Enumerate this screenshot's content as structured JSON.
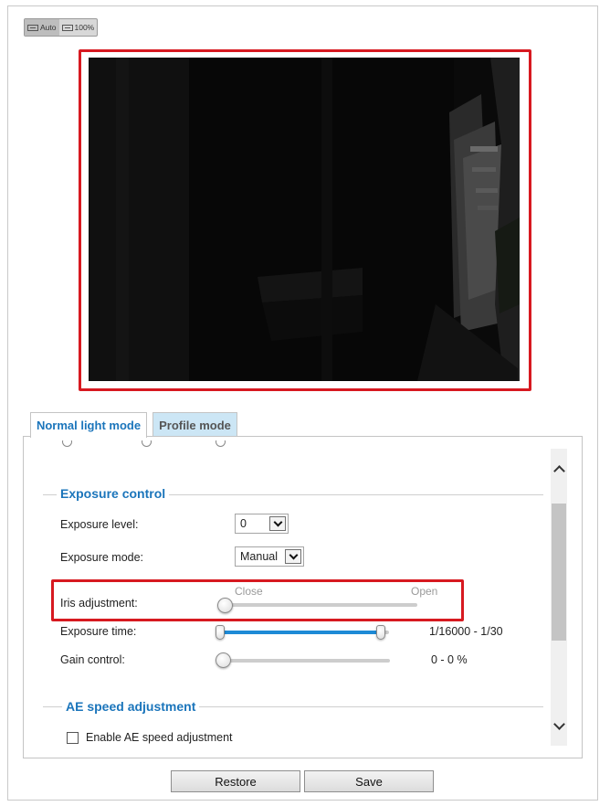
{
  "view_toggle": {
    "auto_label": "Auto",
    "full_label": "100%"
  },
  "tabs": {
    "normal": "Normal light mode",
    "profile": "Profile mode"
  },
  "exposure_control": {
    "title": "Exposure control",
    "exposure_level": {
      "label": "Exposure level:",
      "value": "0"
    },
    "exposure_mode": {
      "label": "Exposure mode:",
      "value": "Manual"
    },
    "iris": {
      "label": "Iris adjustment:",
      "min_label": "Close",
      "max_label": "Open",
      "position": 0
    },
    "exposure_time": {
      "label": "Exposure time:",
      "range_text": "1/16000 - 1/30",
      "low": 0,
      "high": 0.97
    },
    "gain_control": {
      "label": "Gain control:",
      "range_text": "0 - 0 %",
      "low": 0,
      "high": 0
    }
  },
  "ae_speed": {
    "title": "AE speed adjustment",
    "enable_label": "Enable AE speed adjustment",
    "enabled": false
  },
  "buttons": {
    "restore": "Restore",
    "save": "Save"
  }
}
